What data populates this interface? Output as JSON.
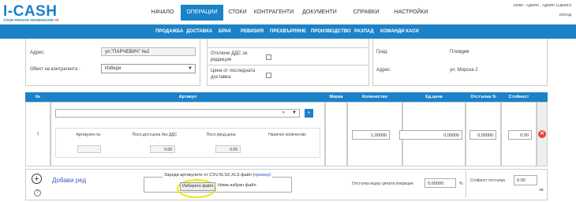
{
  "app": {
    "logo": "I-CASH",
    "tagline": "YOUR PRIVATE WAREHOUSE",
    "version": "V5"
  },
  "nav": [
    "НАЧАЛО",
    "ОПЕРАЦИИ",
    "СТОКИ",
    "КОНТРАГЕНТИ",
    "ДОКУМЕНТИ",
    "СПРАВКИ",
    "НАСТРОЙКИ"
  ],
  "user": {
    "info": "10899 - АДМИН , АДМИН (АДМИН)",
    "logout": "ИЗХОД"
  },
  "subnav": [
    "ПРОДАЖБА",
    "ДОСТАВКА",
    "БРАК",
    "РЕВИЗИЯ",
    "ПРЕХВЪРЛЯНЕ",
    "ПРОИЗВОДСТВО",
    "РАЗПАД",
    "КОМАНДИ КАСИ"
  ],
  "form": {
    "address_label": "Адрес:",
    "address_value": "ул.\"ПАРЧЕВИЧ\" №2",
    "object_label": "Обект на контрагента :",
    "object_value": "Избери",
    "vat_label": "Отключи ДДС за редакция",
    "lastprice_label": "Цена от последната доставка",
    "city_label": "Град:",
    "city_value": "Пловдив",
    "address2_label": "Адрес:",
    "address2_value": "ул. Морска 2"
  },
  "table": {
    "headers": [
      "№",
      "Артикул",
      "Мярка",
      "Количество",
      "Ед.цена",
      "Отстъпка %",
      "Стойност"
    ],
    "row": {
      "num": "1",
      "article_arrows": "»",
      "add_btn": "+",
      "sub_headers": [
        "Артикулен №",
        "Посл.дост.цена без ДДС",
        "Посл.прод.цена",
        "Налично количество"
      ],
      "last_delivery_price": "0.00",
      "last_sale_price": "0.00",
      "qty": "1,00000",
      "unit_price": "0,00000",
      "discount": "0,00000",
      "value": "0.00"
    }
  },
  "footer": {
    "add_row": "Добави ред",
    "import_label": "Зареди артикулите от CSV,XLSX,XLS файл (",
    "import_link": "пример",
    "import_close": ")",
    "choose_file": "Изберете файл",
    "no_file": "Няма избран файл",
    "total_discount_label": "Отстъпка върху цялата операция",
    "total_discount_value": "0,00000",
    "percent": "%",
    "discount_value_label": "Стойност отстъпка",
    "discount_value": "0.00",
    "currency": "лв."
  },
  "colors": {
    "accent": "#1b82c8",
    "delete": "#e0463a",
    "highlight": "#f2e600"
  }
}
